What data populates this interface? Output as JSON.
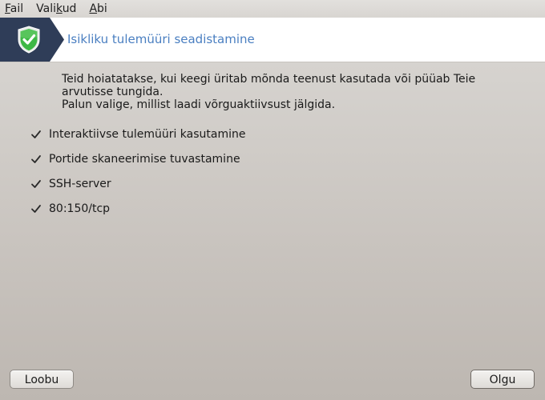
{
  "menubar": {
    "items": [
      {
        "accel": "F",
        "rest": "ail"
      },
      {
        "pre": "Vali",
        "accel": "k",
        "rest": "ud"
      },
      {
        "accel": "A",
        "rest": "bi"
      }
    ]
  },
  "header": {
    "icon": "shield-check-icon",
    "title": "Isikliku tulemüüri seadistamine"
  },
  "intro": {
    "line1": "Teid hoiatatakse, kui keegi üritab mõnda teenust kasutada või püüab Teie",
    "line2": "arvutisse tungida.",
    "line3": "Palun valige, millist laadi võrguaktiivsust jälgida."
  },
  "options": [
    {
      "label": "Interaktiivse tulemüüri kasutamine",
      "checked": true
    },
    {
      "label": "Portide skaneerimise tuvastamine",
      "checked": true
    },
    {
      "label": "SSH-server",
      "checked": true
    },
    {
      "label": "80:150/tcp",
      "checked": true
    }
  ],
  "buttons": {
    "cancel": "Loobu",
    "ok": "Olgu"
  },
  "colors": {
    "badge_bg": "#2f3d58",
    "shield_green": "#3db845",
    "title_blue": "#4a7fc1"
  }
}
